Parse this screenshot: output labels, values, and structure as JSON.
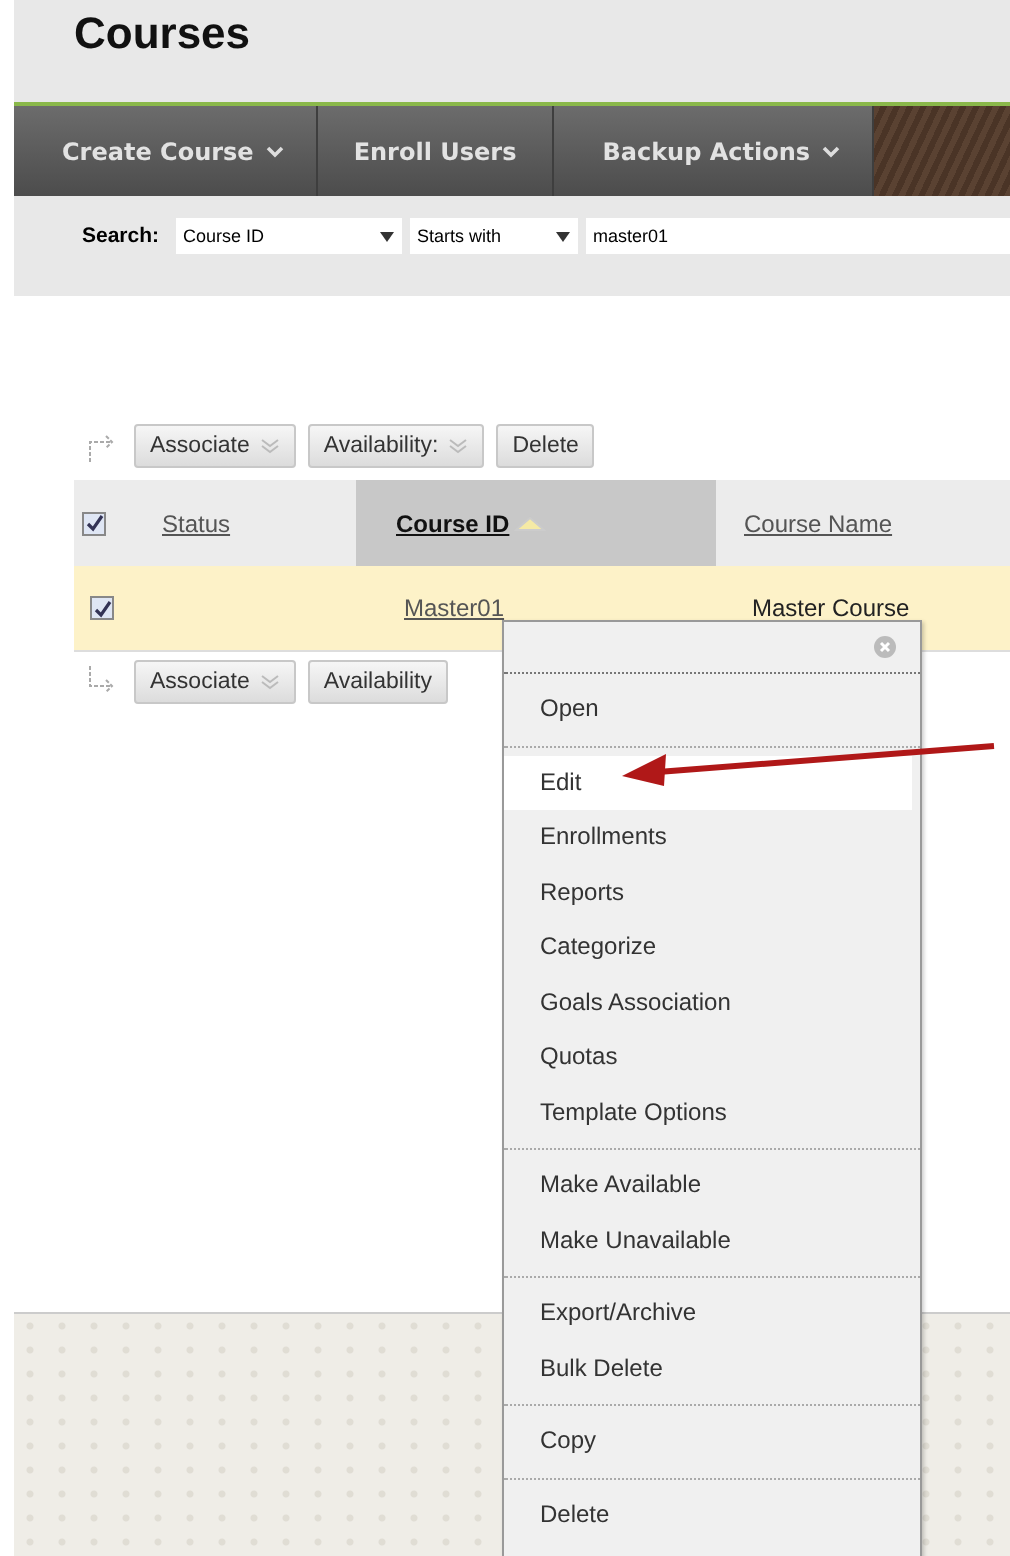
{
  "page_title": "Courses",
  "nav": [
    {
      "label": "Create Course",
      "dropdown": true
    },
    {
      "label": "Enroll Users",
      "dropdown": false
    },
    {
      "label": "Backup Actions",
      "dropdown": true
    }
  ],
  "search": {
    "label": "Search:",
    "field": "Course ID",
    "operator": "Starts with",
    "value": "master01"
  },
  "top_actions": [
    {
      "label": "Associate",
      "dropdown": true
    },
    {
      "label": "Availability:",
      "dropdown": true
    },
    {
      "label": "Delete",
      "dropdown": false
    }
  ],
  "table": {
    "select_all_checked": true,
    "columns": [
      {
        "label": "Status",
        "sorted": false
      },
      {
        "label": "Course ID",
        "sorted": true
      },
      {
        "label": "Course Name",
        "sorted": false
      }
    ],
    "rows": [
      {
        "checked": true,
        "selected": true,
        "course_id": "Master01",
        "course_name": "Master Course"
      }
    ]
  },
  "bottom_actions": [
    {
      "label": "Associate",
      "dropdown": true
    },
    {
      "label": "Availability",
      "dropdown": false
    }
  ],
  "context_menu": {
    "groups": [
      [
        {
          "label": "Open",
          "selected": false
        }
      ],
      [
        {
          "label": "Edit",
          "selected": true
        },
        {
          "label": "Enrollments",
          "selected": false
        },
        {
          "label": "Reports",
          "selected": false
        },
        {
          "label": "Categorize",
          "selected": false
        },
        {
          "label": "Goals Association",
          "selected": false
        },
        {
          "label": "Quotas",
          "selected": false
        },
        {
          "label": "Template Options",
          "selected": false
        }
      ],
      [
        {
          "label": "Make Available",
          "selected": false
        },
        {
          "label": "Make Unavailable",
          "selected": false
        }
      ],
      [
        {
          "label": "Export/Archive",
          "selected": false
        },
        {
          "label": "Bulk Delete",
          "selected": false
        }
      ],
      [
        {
          "label": "Copy",
          "selected": false
        }
      ],
      [
        {
          "label": "Delete",
          "selected": false
        }
      ]
    ]
  }
}
